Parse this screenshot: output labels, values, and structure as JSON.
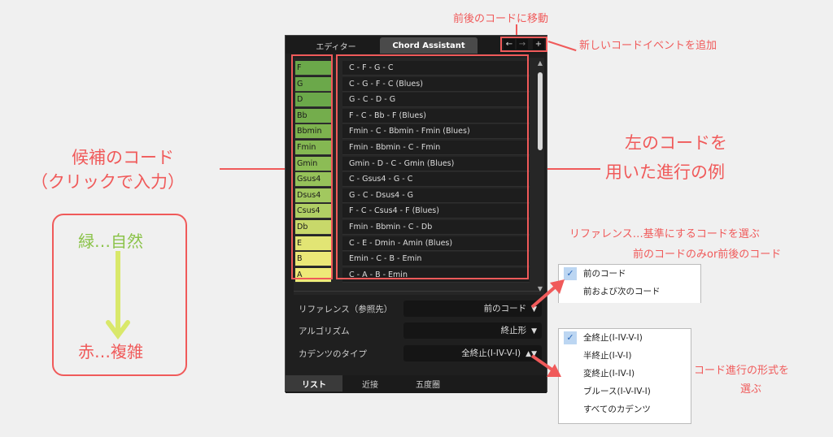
{
  "annotations": {
    "nav_label": "前後のコードに移動",
    "add_label": "新しいコードイベントを追加",
    "candidates_line1": "候補のコード",
    "candidates_line2": "（クリックで入力）",
    "progression_line1": "左のコードを",
    "progression_line2": "用いた進行の例",
    "reference_line1": "リファレンス…基準にするコードを選ぶ",
    "reference_line2": "前のコードのみor前後のコード",
    "cadence_line1": "コード進行の形式を",
    "cadence_line2": "選ぶ",
    "legend_green": "緑…自然",
    "legend_red": "赤…複雑",
    "legend_arrow_color": "#d9e86a",
    "green_text_color": "#8bc34a",
    "accent_color": "#f05a5a"
  },
  "panel": {
    "tabs": {
      "editor": "エディター",
      "assistant": "Chord Assistant"
    },
    "nav": {
      "prev_icon": "←",
      "next_icon": "→",
      "add_icon": "+"
    },
    "rows": [
      {
        "chord": "F",
        "progression": "C - F - G - C",
        "color": "#6ba84a"
      },
      {
        "chord": "G",
        "progression": "C - G - F - C (Blues)",
        "color": "#6ba84a"
      },
      {
        "chord": "D",
        "progression": "G - C - D - G",
        "color": "#6ba84a"
      },
      {
        "chord": "Bb",
        "progression": "F - C - Bb - F (Blues)",
        "color": "#74ad4c"
      },
      {
        "chord": "Bbmin",
        "progression": "Fmin - C - Bbmin - Fmin (Blues)",
        "color": "#7db34e"
      },
      {
        "chord": "Fmin",
        "progression": "Fmin - Bbmin - C - Fmin",
        "color": "#84b752"
      },
      {
        "chord": "Gmin",
        "progression": "Gmin - D - C - Gmin (Blues)",
        "color": "#8cbc55"
      },
      {
        "chord": "Gsus4",
        "progression": "C - Gsus4 - G - C",
        "color": "#96c25a"
      },
      {
        "chord": "Dsus4",
        "progression": "G - C - Dsus4 - G",
        "color": "#a2c85f"
      },
      {
        "chord": "Csus4",
        "progression": "F - C - Csus4 - F (Blues)",
        "color": "#b0cf64"
      },
      {
        "chord": "Db",
        "progression": "Fmin - Bbmin - C - Db",
        "color": "#c8d86a"
      },
      {
        "chord": "E",
        "progression": "C - E - Dmin - Amin (Blues)",
        "color": "#e2e574"
      },
      {
        "chord": "B",
        "progression": "Emin - C - B - Emin",
        "color": "#ebe877"
      },
      {
        "chord": "A",
        "progression": "C - A - B - Emin",
        "color": "#eeea78"
      }
    ],
    "settings": [
      {
        "label": "リファレンス（参照先）",
        "value": "前のコード",
        "arrow": "▼"
      },
      {
        "label": "アルゴリズム",
        "value": "終止形",
        "arrow": "▼"
      },
      {
        "label": "カデンツのタイプ",
        "value": "全終止(I-IV-V-I)",
        "arrow": "▲▼"
      }
    ],
    "bottom_tabs": [
      "リスト",
      "近接",
      "五度圏"
    ]
  },
  "reference_dropdown": {
    "options": [
      {
        "label": "前のコード",
        "checked": true
      },
      {
        "label": "前および次のコード",
        "checked": false
      }
    ]
  },
  "cadence_dropdown": {
    "options": [
      {
        "label": "全終止(I-IV-V-I)",
        "checked": true
      },
      {
        "label": "半終止(I-V-I)",
        "checked": false
      },
      {
        "label": "変終止(I-IV-I)",
        "checked": false
      },
      {
        "label": "ブルース(I-V-IV-I)",
        "checked": false
      },
      {
        "label": "すべてのカデンツ",
        "checked": false
      }
    ]
  }
}
